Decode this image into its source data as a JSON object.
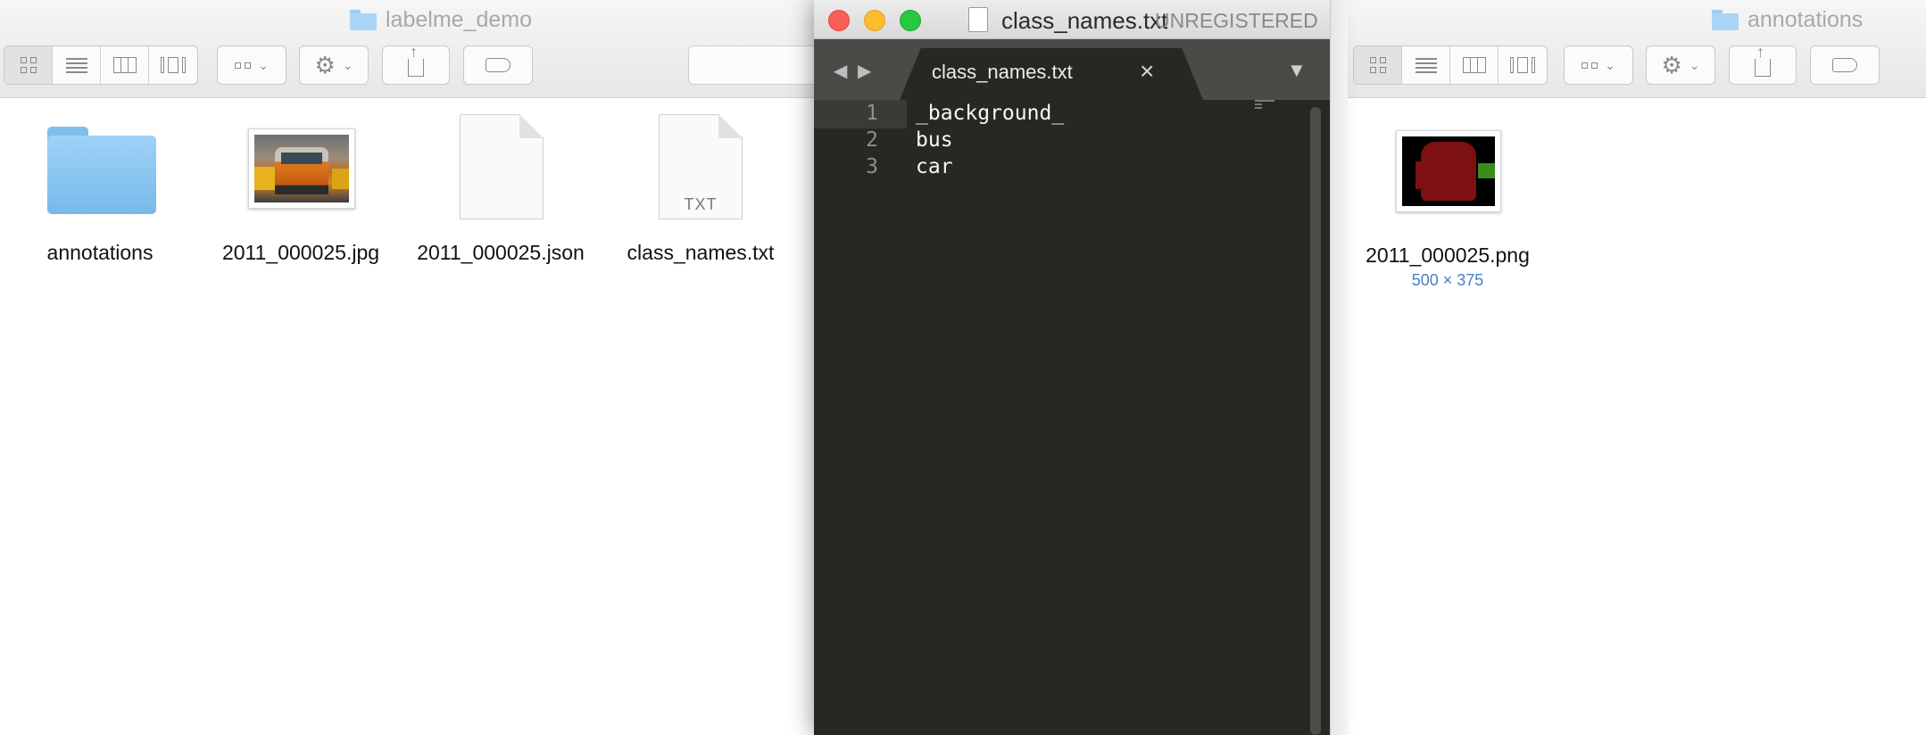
{
  "finder_left": {
    "title": "labelme_demo",
    "files": [
      {
        "name": "annotations",
        "kind": "folder-icon"
      },
      {
        "name": "2011_000025.jpg",
        "kind": "image-thumbnail"
      },
      {
        "name": "2011_000025.json",
        "kind": "document-icon"
      },
      {
        "name": "class_names.txt",
        "kind": "text-document-icon",
        "badge": "TXT"
      }
    ]
  },
  "finder_right": {
    "title": "annotations",
    "files": [
      {
        "name": "2011_000025.png",
        "kind": "image-thumbnail",
        "dimensions": "500 × 375"
      }
    ]
  },
  "editor": {
    "window_title": "class_names.txt",
    "license_status": "UNREGISTERED",
    "tab_label": "class_names.txt",
    "lines": [
      {
        "number": "1",
        "text": "_background_"
      },
      {
        "number": "2",
        "text": "bus"
      },
      {
        "number": "3",
        "text": "car"
      }
    ]
  },
  "colors": {
    "editor_bg": "#272822",
    "editor_text": "#f8f8f2",
    "folder_blue": "#8ac6f2",
    "size_label_blue": "#4a7fc4"
  }
}
